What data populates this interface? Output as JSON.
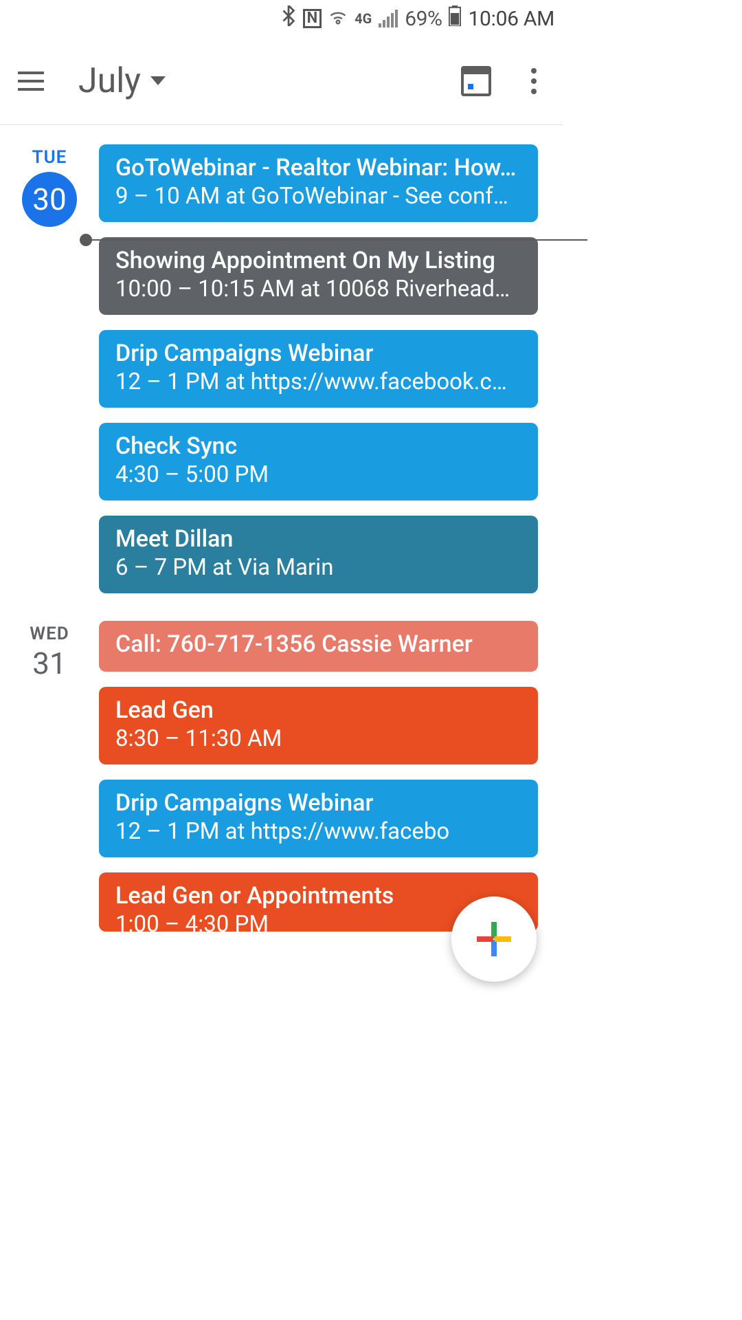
{
  "status": {
    "network_label": "4G",
    "battery": "69%",
    "time": "10:06 AM"
  },
  "appbar": {
    "month": "July"
  },
  "days": [
    {
      "label": "TUE",
      "num": "30",
      "today": true,
      "events": [
        {
          "title": "GoToWebinar - Realtor Webinar: How…",
          "time": "9 – 10 AM at GoToWebinar - See conf…",
          "color": "bg-blue1"
        },
        {
          "title": "Showing Appointment On My Listing",
          "time": "10:00 – 10:15 AM at 10068 Riverhead…",
          "color": "bg-grey"
        },
        {
          "title": "Drip Campaigns Webinar",
          "time": "12 – 1 PM at https://www.facebook.c…",
          "color": "bg-blue2"
        },
        {
          "title": "Check Sync",
          "time": "4:30 – 5:00 PM",
          "color": "bg-blue2"
        },
        {
          "title": "Meet Dillan",
          "time": "6 – 7 PM at Via Marin",
          "color": "bg-teal"
        }
      ]
    },
    {
      "label": "WED",
      "num": "31",
      "today": false,
      "events": [
        {
          "title": "Call: 760-717-1356 Cassie Warner",
          "time": "",
          "color": "bg-pink",
          "small": true
        },
        {
          "title": "Lead Gen",
          "time": "8:30 – 11:30 AM",
          "color": "bg-orange"
        },
        {
          "title": "Drip Campaigns Webinar",
          "time": "12 – 1 PM at https://www.facebo",
          "color": "bg-blue2"
        },
        {
          "title": "Lead Gen or Appointments",
          "time": "1:00 – 4:30 PM",
          "color": "bg-orange",
          "partial": true
        }
      ]
    }
  ]
}
